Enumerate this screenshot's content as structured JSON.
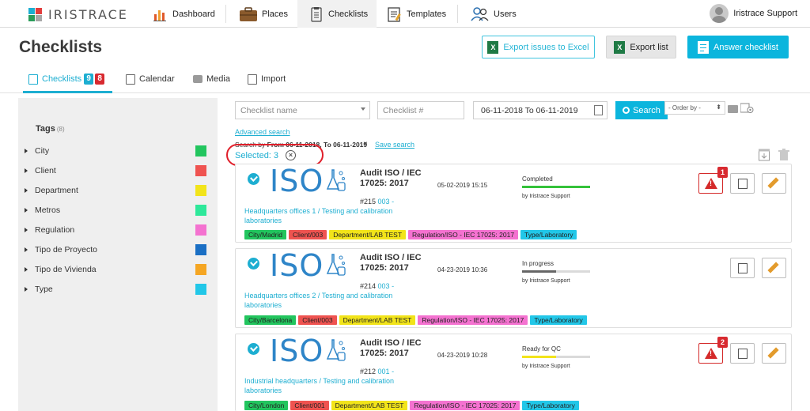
{
  "app": {
    "logo_text": "IRISTRACE"
  },
  "nav": {
    "items": [
      {
        "label": "Dashboard",
        "icon": "bar-chart-icon"
      },
      {
        "label": "Places",
        "icon": "briefcase-icon"
      },
      {
        "label": "Checklists",
        "icon": "clipboard-icon"
      },
      {
        "label": "Templates",
        "icon": "templates-icon"
      },
      {
        "label": "Users",
        "icon": "users-icon"
      }
    ],
    "user_name": "Iristrace Support"
  },
  "header": {
    "title": "Checklists",
    "export_issues_label": "Export issues to Excel",
    "export_list_label": "Export list",
    "answer_label": "Answer checklist",
    "excel_glyph": "X"
  },
  "subtabs": {
    "checklists": {
      "label": "Checklists",
      "badge_blue": "9",
      "badge_red": "8"
    },
    "calendar": "Calendar",
    "media": "Media",
    "import": "Import"
  },
  "sidebar": {
    "tags_title": "Tags",
    "tags_count": "(8)",
    "tags": [
      {
        "label": "City",
        "color": "#22c55e"
      },
      {
        "label": "Client",
        "color": "#ef5350"
      },
      {
        "label": "Department",
        "color": "#f2e41a"
      },
      {
        "label": "Metros",
        "color": "#2ee89a"
      },
      {
        "label": "Regulation",
        "color": "#f472d0"
      },
      {
        "label": "Tipo de Proyecto",
        "color": "#1a6fc4"
      },
      {
        "label": "Tipo de Vivienda",
        "color": "#f5a623"
      },
      {
        "label": "Type",
        "color": "#22c7e8"
      }
    ]
  },
  "filters": {
    "name_placeholder": "Checklist name",
    "number_placeholder": "Checklist #",
    "date_range": "06-11-2018 To 06-11-2019",
    "search_label": "Search",
    "order_by": "- Order by -",
    "advanced_search": "Advanced search",
    "search_by_prefix": "Search by",
    "search_by_value": "From 06-11-2018, To 06-11-2019",
    "remove_glyph": "×",
    "save_search": "Save search",
    "selected_label": "Selected: 3",
    "clear_glyph": "×"
  },
  "cards": [
    {
      "logo": "ISO",
      "title": "Audit ISO / IEC 17025: 2017",
      "num_prefix": "#215",
      "code": "003 -",
      "location": "Headquarters offices 1 / Testing and calibration laboratories",
      "date": "05-02-2019 15:15",
      "status": "Completed",
      "progress": 1.0,
      "progress_color": "#35c23a",
      "by": "by Iristrace Support",
      "issues": "1",
      "tags": [
        {
          "label": "City/Madrid",
          "color": "#22c55e"
        },
        {
          "label": "Client/003",
          "color": "#ef5350"
        },
        {
          "label": "Department/LAB TEST",
          "color": "#f2e41a"
        },
        {
          "label": "Regulation/ISO - IEC 17025: 2017",
          "color": "#f472d0"
        },
        {
          "label": "Type/Laboratory",
          "color": "#22c7e8"
        }
      ]
    },
    {
      "logo": "ISO",
      "title": "Audit ISO / IEC 17025: 2017",
      "num_prefix": "#214",
      "code": "003 -",
      "location": "Headquarters offices 2 / Testing and calibration laboratories",
      "date": "04-23-2019 10:36",
      "status": "In progress",
      "progress": 0.5,
      "progress_color": "#666666",
      "by": "by Iristrace Support",
      "issues": "",
      "tags": [
        {
          "label": "City/Barcelona",
          "color": "#22c55e"
        },
        {
          "label": "Client/003",
          "color": "#ef5350"
        },
        {
          "label": "Department/LAB TEST",
          "color": "#f2e41a"
        },
        {
          "label": "Regulation/ISO - IEC 17025: 2017",
          "color": "#f472d0"
        },
        {
          "label": "Type/Laboratory",
          "color": "#22c7e8"
        }
      ]
    },
    {
      "logo": "ISO",
      "title": "Audit ISO / IEC 17025: 2017",
      "num_prefix": "#212",
      "code": "001 -",
      "location": "Industrial headquarters / Testing and calibration laboratories",
      "date": "04-23-2019 10:28",
      "status": "Ready for QC",
      "progress": 0.5,
      "progress_color": "#f2e41a",
      "by": "by Iristrace Support",
      "issues": "2",
      "tags": [
        {
          "label": "City/London",
          "color": "#22c55e"
        },
        {
          "label": "Client/001",
          "color": "#ef5350"
        },
        {
          "label": "Department/LAB TEST",
          "color": "#f2e41a"
        },
        {
          "label": "Regulation/ISO - IEC 17025: 2017",
          "color": "#f472d0"
        },
        {
          "label": "Type/Laboratory",
          "color": "#22c7e8"
        }
      ]
    }
  ]
}
